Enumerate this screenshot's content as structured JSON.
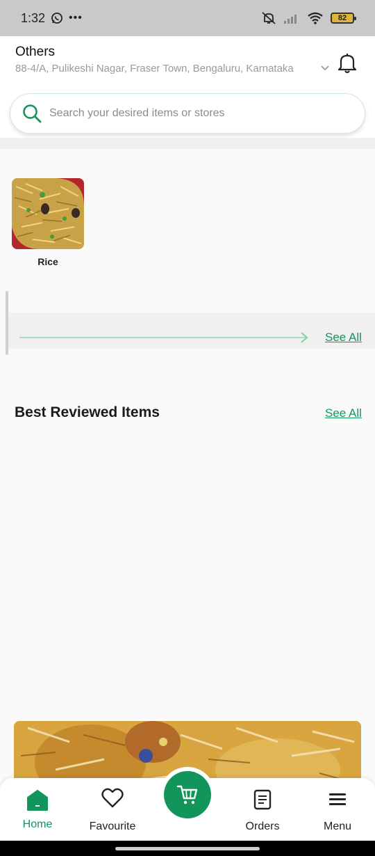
{
  "status_bar": {
    "time": "1:32",
    "battery": "82"
  },
  "header": {
    "location_title": "Others",
    "address": "88-4/A, Pulikeshi Nagar, Fraser Town, Bengaluru, Karnataka"
  },
  "search": {
    "placeholder": "Search your desired items or stores"
  },
  "categories": [
    {
      "label": "Rice"
    }
  ],
  "see_all_1": "See All",
  "best_reviewed": {
    "title": "Best Reviewed Items",
    "see_all": "See All"
  },
  "bottom_nav": {
    "home": "Home",
    "favourite": "Favourite",
    "orders": "Orders",
    "menu": "Menu"
  },
  "colors": {
    "accent": "#12955a",
    "accent_light": "#a9dfc4"
  }
}
